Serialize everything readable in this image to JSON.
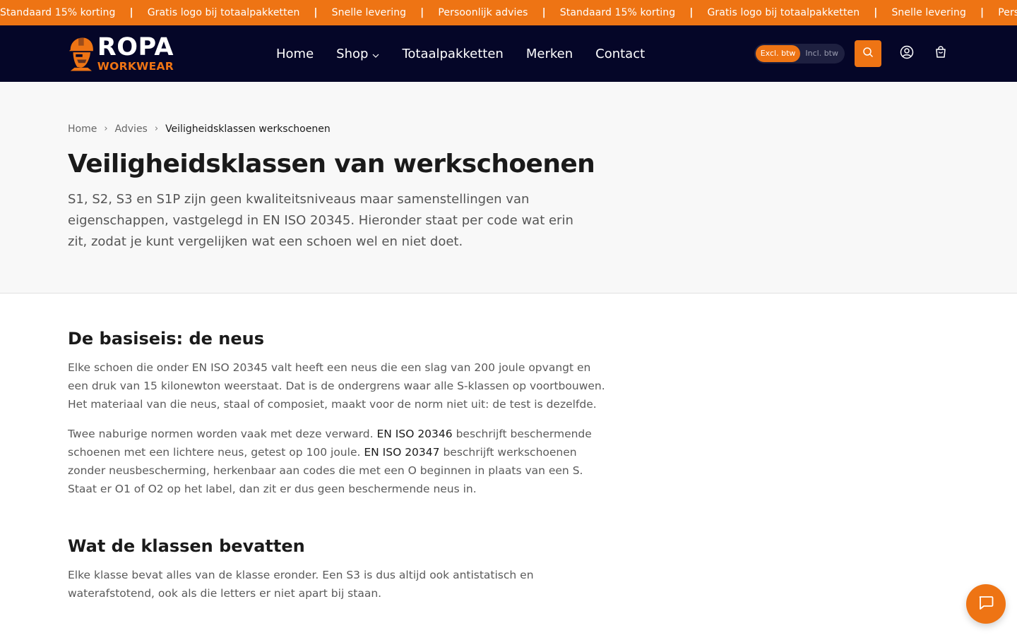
{
  "announcement": {
    "items": [
      "Standaard 15% korting",
      "Gratis logo bij totaalpakketten",
      "Snelle levering",
      "Persoonlijk advies",
      "Standaard 15% korting",
      "Gratis logo bij totaalpakketten",
      "Snelle levering",
      "Persoonlijk advies"
    ],
    "separator": "|"
  },
  "brand": {
    "name": "ROPA",
    "tagline": "WORKWEAR"
  },
  "nav": {
    "home": "Home",
    "shop": "Shop",
    "packages": "Totaalpakketten",
    "brands": "Merken",
    "contact": "Contact"
  },
  "vat_toggle": {
    "excl": "Excl. btw",
    "incl": "Incl. btw",
    "selected": "excl"
  },
  "icons": {
    "search": "search-icon",
    "account": "user-icon",
    "cart": "cart-icon",
    "chat": "chat-icon"
  },
  "colors": {
    "accent": "#ee7414",
    "header_bg": "#050628",
    "hero_bg": "#f8f8f8"
  },
  "breadcrumb": {
    "home": "Home",
    "advice": "Advies",
    "current": "Veiligheidsklassen werkschoenen"
  },
  "hero": {
    "title": "Veiligheidsklassen van werkschoenen",
    "lead": "S1, S2, S3 en S1P zijn geen kwaliteitsniveaus maar samenstellingen van eigenschappen, vastgelegd in EN ISO 20345. Hieronder staat per code wat erin zit, zodat je kunt vergelijken wat een schoen wel en niet doet."
  },
  "section1": {
    "heading": "De basiseis: de neus",
    "p1": "Elke schoen die onder EN ISO 20345 valt heeft een neus die een slag van 200 joule opvangt en een druk van 15 kilonewton weerstaat. Dat is de ondergrens waar alle S-klassen op voortbouwen. Het materiaal van die neus, staal of composiet, maakt voor de norm niet uit: de test is dezelfde.",
    "p2_a": "Twee naburige normen worden vaak met deze verward. ",
    "p2_b": "EN ISO 20346",
    "p2_c": " beschrijft beschermende schoenen met een lichtere neus, getest op 100 joule. ",
    "p2_d": "EN ISO 20347",
    "p2_e": " beschrijft werkschoenen zonder neusbescherming, herkenbaar aan codes die met een O beginnen in plaats van een S. Staat er O1 of O2 op het label, dan zit er dus geen beschermende neus in."
  },
  "section2": {
    "heading": "Wat de klassen bevatten",
    "p1": "Elke klasse bevat alles van de klasse eronder. Een S3 is dus altijd ook antistatisch en waterafstotend, ook als die letters er niet apart bij staan."
  }
}
